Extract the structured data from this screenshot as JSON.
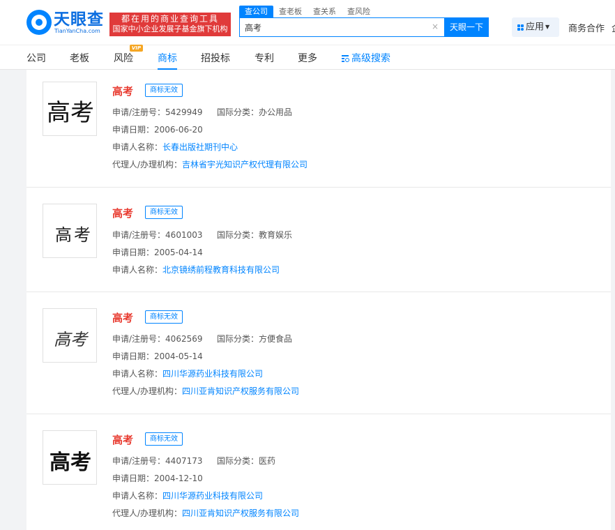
{
  "header": {
    "logo_name": "天眼查",
    "logo_sub": "TianYanCha.com",
    "slogan_line1": "都在用的商业查询工具",
    "slogan_line2": "国家中小企业发展子基金旗下机构",
    "search_tabs": [
      "查公司",
      "查老板",
      "查关系",
      "查风险"
    ],
    "search_value": "高考",
    "clear_glyph": "×",
    "search_button": "天眼一下",
    "apps_label": "应用",
    "biz_label": "商务合作",
    "edge_char": "企"
  },
  "nav": {
    "items": [
      "公司",
      "老板",
      "风险",
      "商标",
      "招投标",
      "专利",
      "更多"
    ],
    "vip_badge": "VIP",
    "advanced_search": "高级搜索",
    "active": "商标"
  },
  "labels": {
    "reg_no": "申请/注册号：",
    "intl_class": "国际分类：",
    "apply_date": "申请日期：",
    "applicant": "申请人名称：",
    "agent": "代理人/办理机构："
  },
  "results": [
    {
      "name": "高考",
      "status": "商标无效",
      "reg_no": "5429949",
      "intl_class": "办公用品",
      "apply_date": "2006-06-20",
      "applicant": "长春出版社期刊中心",
      "agent": "吉林省宇光知识产权代理有限公司",
      "logo_text": "高考"
    },
    {
      "name": "高考",
      "status": "商标无效",
      "reg_no": "4601003",
      "intl_class": "教育娱乐",
      "apply_date": "2005-04-14",
      "applicant": "北京镜绣前程教育科技有限公司",
      "agent": "",
      "logo_text": "高考"
    },
    {
      "name": "高考",
      "status": "商标无效",
      "reg_no": "4062569",
      "intl_class": "方便食品",
      "apply_date": "2004-05-14",
      "applicant": "四川华源药业科技有限公司",
      "agent": "四川亚肯知识产权服务有限公司",
      "logo_text": "高考"
    },
    {
      "name": "高考",
      "status": "商标无效",
      "reg_no": "4407173",
      "intl_class": "医药",
      "apply_date": "2004-12-10",
      "applicant": "四川华源药业科技有限公司",
      "agent": "四川亚肯知识产权服务有限公司",
      "logo_text": "高考"
    }
  ]
}
